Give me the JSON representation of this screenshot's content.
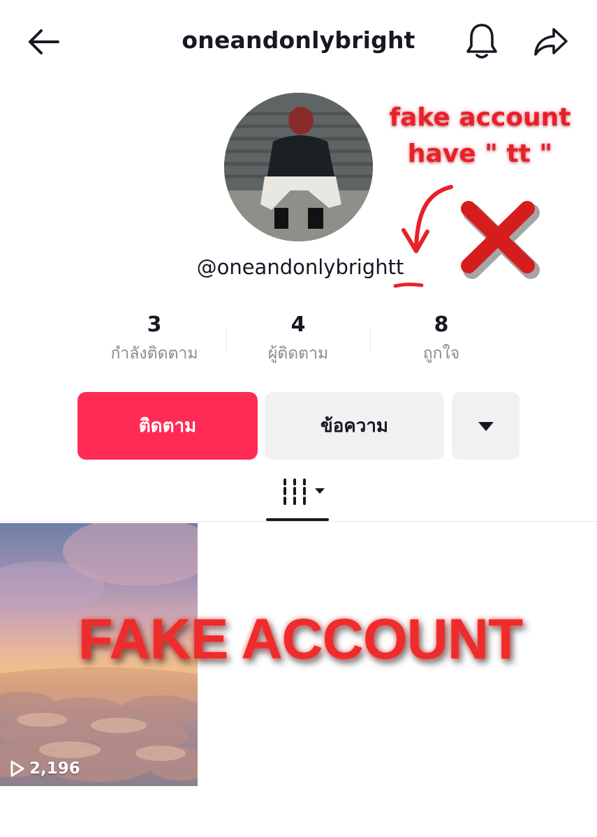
{
  "header": {
    "title": "oneandonlybright",
    "back_icon": "arrow-left-icon",
    "bell_icon": "bell-icon",
    "share_icon": "share-arrow-icon"
  },
  "profile": {
    "handle": "@oneandonlybrightt"
  },
  "stats": [
    {
      "value": "3",
      "label": "กำลังติดตาม"
    },
    {
      "value": "4",
      "label": "ผู้ติดตาม"
    },
    {
      "value": "8",
      "label": "ถูกใจ"
    }
  ],
  "actions": {
    "follow_label": "ติดตาม",
    "message_label": "ข้อความ",
    "more_icon": "caret-down-icon"
  },
  "tabs": {
    "videos_icon": "video-grid-icon"
  },
  "videos": [
    {
      "views": "2,196"
    }
  ],
  "annotations": {
    "note_line1": "fake account",
    "note_line2": "have \" tt \"",
    "banner": "FAKE ACCOUNT"
  },
  "colors": {
    "accent": "#fe2c55",
    "annotation_red": "#e8202a",
    "secondary_button": "#f1f1f2"
  }
}
